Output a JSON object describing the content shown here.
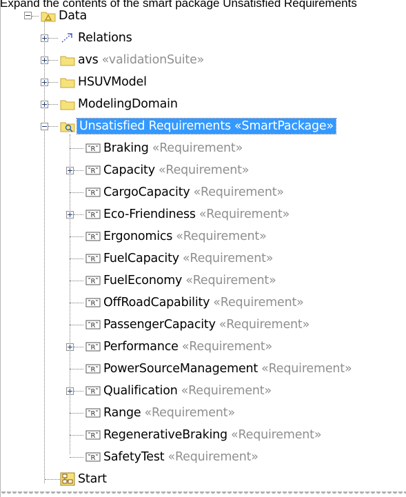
{
  "caption": "Expand the contents of the smart package Unsatisfied Requirements",
  "tree": {
    "root": {
      "label": "Data",
      "icon": "package-icon",
      "expanded": true
    },
    "nodes": [
      {
        "label": "Relations",
        "stereotype": "",
        "icon": "relations-icon",
        "expandable": true
      },
      {
        "label": "avs",
        "stereotype": "«validationSuite»",
        "icon": "folder-icon",
        "expandable": true
      },
      {
        "label": "HSUVModel",
        "stereotype": "",
        "icon": "folder-icon",
        "expandable": true
      },
      {
        "label": "ModelingDomain",
        "stereotype": "",
        "icon": "folder-icon",
        "expandable": true
      },
      {
        "label": "Unsatisfied Requirements",
        "stereotype": "«SmartPackage»",
        "icon": "smart-package-icon",
        "expandable": true,
        "expanded": true,
        "selected": true
      }
    ],
    "requirements": [
      {
        "label": "Braking",
        "stereotype": "«Requirement»",
        "expandable": false
      },
      {
        "label": "Capacity",
        "stereotype": "«Requirement»",
        "expandable": true
      },
      {
        "label": "CargoCapacity",
        "stereotype": "«Requirement»",
        "expandable": false
      },
      {
        "label": "Eco-Friendiness",
        "stereotype": "«Requirement»",
        "expandable": true
      },
      {
        "label": "Ergonomics",
        "stereotype": "«Requirement»",
        "expandable": false
      },
      {
        "label": "FuelCapacity",
        "stereotype": "«Requirement»",
        "expandable": false
      },
      {
        "label": "FuelEconomy",
        "stereotype": "«Requirement»",
        "expandable": false
      },
      {
        "label": "OffRoadCapability",
        "stereotype": "«Requirement»",
        "expandable": false
      },
      {
        "label": "PassengerCapacity",
        "stereotype": "«Requirement»",
        "expandable": false
      },
      {
        "label": "Performance",
        "stereotype": "«Requirement»",
        "expandable": true
      },
      {
        "label": "PowerSourceManagement",
        "stereotype": "«Requirement»",
        "expandable": false
      },
      {
        "label": "Qualification",
        "stereotype": "«Requirement»",
        "expandable": true
      },
      {
        "label": "Range",
        "stereotype": "«Requirement»",
        "expandable": false
      },
      {
        "label": "RegenerativeBraking",
        "stereotype": "«Requirement»",
        "expandable": false
      },
      {
        "label": "SafetyTest",
        "stereotype": "«Requirement»",
        "expandable": false
      }
    ],
    "last": {
      "label": "Start",
      "stereotype": "",
      "icon": "diagram-icon"
    }
  },
  "colors": {
    "selection": "#3399ff",
    "stereotype": "#8f8f8f",
    "folder": "#f5e27a",
    "folder_border": "#c9a43a",
    "requirement": "#555555"
  }
}
